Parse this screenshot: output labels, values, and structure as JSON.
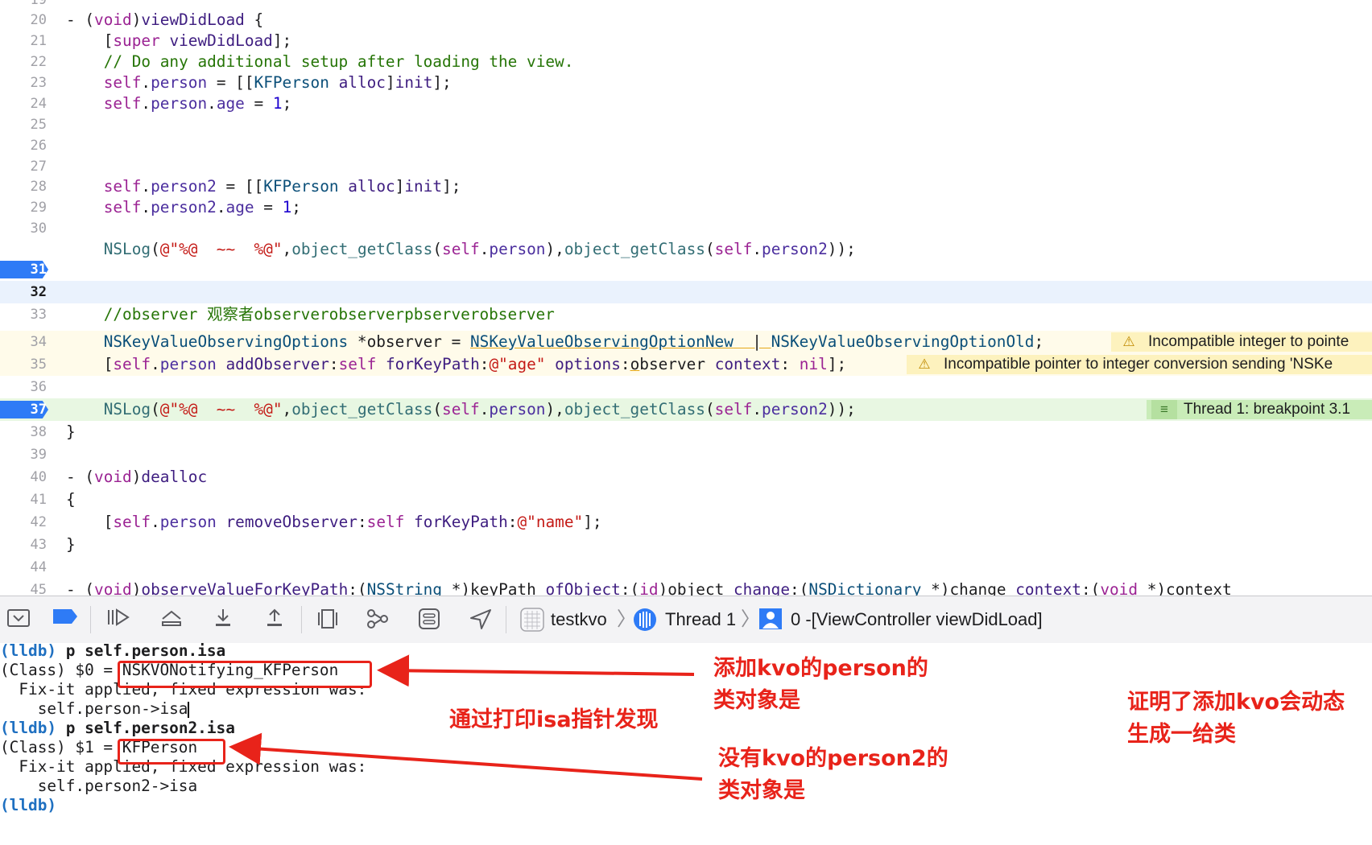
{
  "editor": {
    "lines": {
      "l20": "20",
      "l21": "21",
      "l22": "22",
      "l23": "23",
      "l24": "24",
      "l25": "25",
      "l26": "26",
      "l27": "27",
      "l28": "28",
      "l29": "29",
      "l30": "30",
      "l31": "31",
      "l32": "32",
      "l33": "33",
      "l34": "34",
      "l35": "35",
      "l36": "36",
      "l37": "37",
      "l38": "38",
      "l39": "39",
      "l40": "40",
      "l41": "41",
      "l42": "42",
      "l43": "43",
      "l44": "44",
      "l45": "45"
    },
    "warning_34": "Incompatible integer to pointe",
    "warning_35": "Incompatible pointer to integer conversion sending 'NSKe",
    "breakpoint_37": "Thread 1: breakpoint 3.1"
  },
  "debugbar": {
    "target": "testkvo",
    "thread": "Thread 1",
    "frame": "0 -[ViewController viewDidLoad]"
  },
  "console": {
    "prompt": "(lldb)",
    "cmd1": "p self.person.isa",
    "res1_prefix": "(Class) $0 = ",
    "res1_value": "NSKVONotifying_KFPerson",
    "fix1": "  Fix-it applied, fixed expression was:",
    "expr1": "    self.person->isa",
    "cmd2": "p self.person2.isa",
    "res2_prefix": "(Class) $1 = ",
    "res2_value": "KFPerson",
    "fix2": "  Fix-it applied, fixed expression was:",
    "expr2": "    self.person2->isa"
  },
  "annotations": {
    "note_kvo_line1": "添加kvo的person的",
    "note_kvo_line2": "类对象是",
    "note_isa": "通过打印isa指针发现",
    "note_nokvo_line1": "没有kvo的person2的",
    "note_nokvo_line2": "类对象是",
    "note_conclusion_line1": "证明了添加kvo会动态",
    "note_conclusion_line2": "生成一给类"
  },
  "colors": {
    "breakpoint_blue": "#2e7bf6",
    "warning_yellow": "#fdf2be",
    "breakpoint_green": "#c9ecb8",
    "annotation_red": "#e8231a",
    "lldb_blue": "#1f70c1"
  },
  "icons": [
    "hide-debug-area-icon",
    "breakpoints-toggle-icon",
    "continue-icon",
    "step-over-icon",
    "step-into-icon",
    "step-out-icon",
    "view-hierarchy-icon",
    "memory-graph-icon",
    "environment-overrides-icon",
    "simulate-location-icon",
    "app-icon",
    "thread-icon",
    "stack-frame-icon"
  ]
}
